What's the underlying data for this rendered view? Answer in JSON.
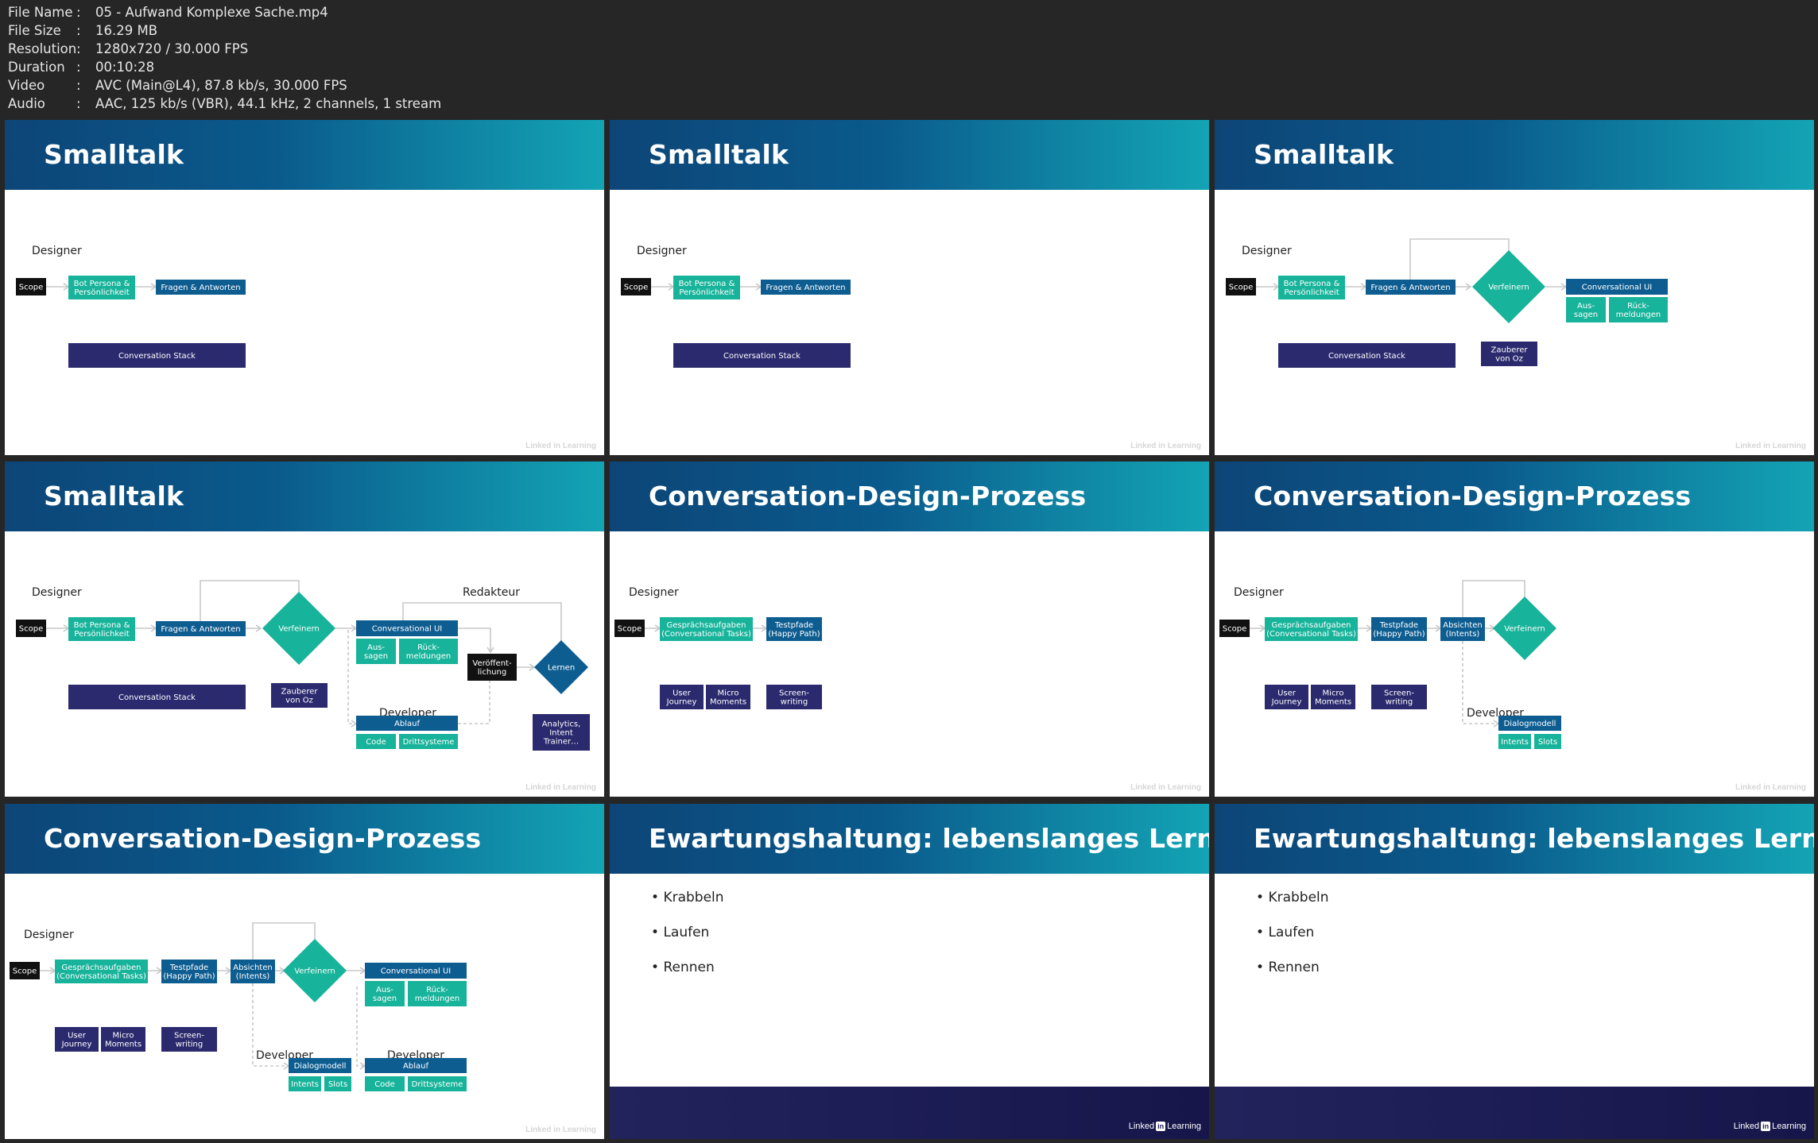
{
  "meta": [
    {
      "key": "File Name",
      "value": "05 - Aufwand Komplexe Sache.mp4"
    },
    {
      "key": "File Size",
      "value": "16.29 MB"
    },
    {
      "key": "Resolution",
      "value": "1280x720 / 30.000 FPS"
    },
    {
      "key": "Duration",
      "value": "00:10:28"
    },
    {
      "key": "Video",
      "value": "AVC (Main@L4), 87.8 kb/s, 30.000 FPS"
    },
    {
      "key": "Audio",
      "value": "AAC, 125 kb/s (VBR), 44.1 kHz, 2 channels, 1 stream"
    }
  ],
  "brand": {
    "faint": "Linked in Learning",
    "name_a": "Linked",
    "name_in": "in",
    "name_b": "Learning"
  },
  "labels": {
    "designer": "Designer",
    "developer": "Developer",
    "redakteur": "Redakteur",
    "scope": "Scope",
    "bot_persona_1": "Bot Persona &",
    "bot_persona_2": "Persönlichkeit",
    "fragen": "Fragen & Antworten",
    "stack": "Conversation Stack",
    "verfeinern": "Verfeinern",
    "cui": "Conversational UI",
    "aussagen_1": "Aus-",
    "aussagen_2": "sagen",
    "rueck_1": "Rück-",
    "rueck_2": "meldungen",
    "oz_1": "Zauberer",
    "oz_2": "von Oz",
    "veroeff_1": "Veröffent-",
    "veroeff_2": "lichung",
    "lernen": "Lernen",
    "analytics_1": "Analytics,",
    "analytics_2": "Intent",
    "analytics_3": "Trainer…",
    "ablauf": "Ablauf",
    "code": "Code",
    "dritt": "Drittsysteme",
    "gespr_1": "Gesprächsaufgaben",
    "gespr_2": "(Conversational Tasks)",
    "test_1": "Testpfade",
    "test_2": "(Happy Path)",
    "uj_1": "User",
    "uj_2": "Journey",
    "mm_1": "Micro",
    "mm_2": "Moments",
    "sw_1": "Screen-",
    "sw_2": "writing",
    "abs_1": "Absichten",
    "abs_2": "(Intents)",
    "dialog": "Dialogmodell",
    "intents": "Intents",
    "slots": "Slots"
  },
  "slides": [
    {
      "title": "Smalltalk"
    },
    {
      "title": "Smalltalk"
    },
    {
      "title": "Smalltalk"
    },
    {
      "title": "Smalltalk"
    },
    {
      "title": "Conversation-Design-Prozess"
    },
    {
      "title": "Conversation-Design-Prozess"
    },
    {
      "title": "Conversation-Design-Prozess"
    },
    {
      "title": "Ewartungshaltung: lebenslanges Lernen",
      "bullets": [
        "Krabbeln",
        "Laufen",
        "Rennen"
      ]
    },
    {
      "title": "Ewartungshaltung: lebenslanges Lernen",
      "bullets": [
        "Krabbeln",
        "Laufen",
        "Rennen"
      ]
    }
  ],
  "colors": {
    "navy": "#2b2a6e",
    "blue": "#0e5d91",
    "teal": "#17b39a",
    "black": "#111111",
    "line": "#c8c8c8"
  }
}
